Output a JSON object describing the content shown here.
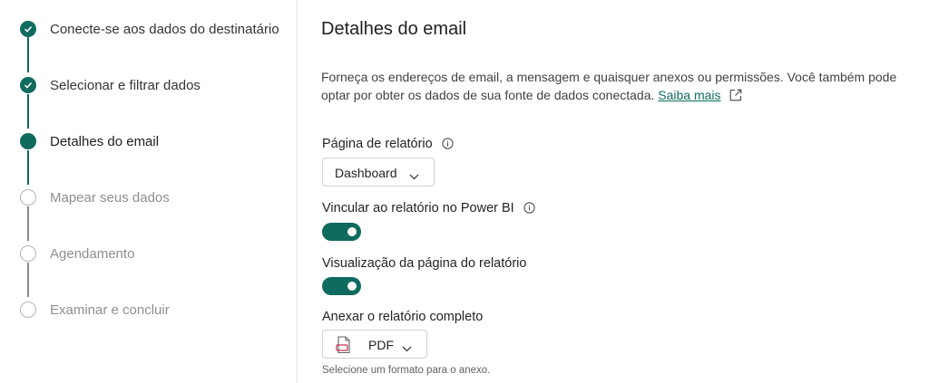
{
  "stepper": {
    "steps": [
      {
        "label": "Conecte-se aos dados do destinatário",
        "state": "done"
      },
      {
        "label": "Selecionar e filtrar dados",
        "state": "done"
      },
      {
        "label": "Detalhes do email",
        "state": "current"
      },
      {
        "label": "Mapear seus dados",
        "state": "todo"
      },
      {
        "label": "Agendamento",
        "state": "todo"
      },
      {
        "label": "Examinar e concluir",
        "state": "todo"
      }
    ]
  },
  "main": {
    "title": "Detalhes do email",
    "description": "Forneça os endereços de email, a mensagem e quaisquer anexos ou permissões. Você também pode optar por obter os dados de sua fonte de dados conectada.",
    "learn_more": "Saiba mais",
    "report_page": {
      "label": "Página de relatório",
      "value": "Dashboard"
    },
    "link_report": {
      "label": "Vincular ao relatório no Power BI",
      "on": true
    },
    "page_preview": {
      "label": "Visualização da página do relatório",
      "on": true
    },
    "attach_full": {
      "label": "Anexar o relatório completo",
      "value": "PDF",
      "hint": "Selecione um formato para o anexo."
    }
  },
  "colors": {
    "accent": "#0f6b5e",
    "todo": "#8f8f8f",
    "divider": "#e1e1e1"
  },
  "icons": [
    "check-icon",
    "info-icon",
    "open-external-icon",
    "chevron-down-icon",
    "pdf-file-icon"
  ]
}
